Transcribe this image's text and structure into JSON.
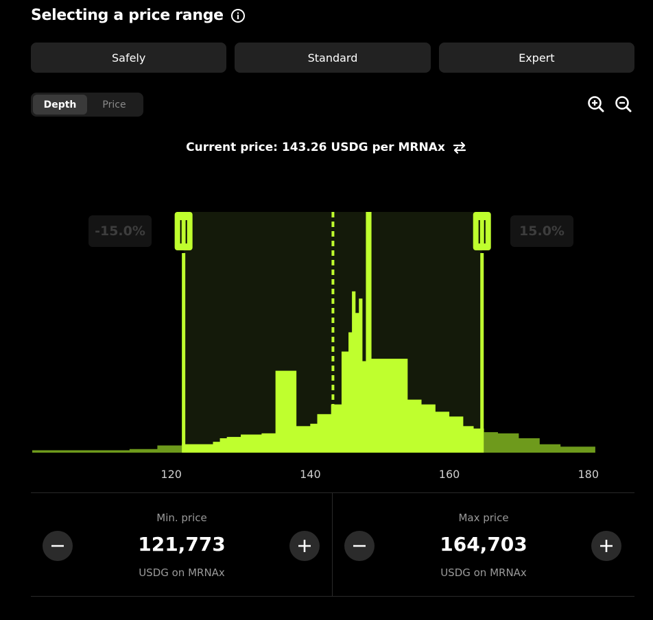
{
  "header": {
    "title": "Selecting a price range",
    "info_icon": "info-circle-icon"
  },
  "strategies": [
    {
      "label": "Safely"
    },
    {
      "label": "Standard"
    },
    {
      "label": "Expert"
    }
  ],
  "view_toggle": {
    "options": [
      "Depth",
      "Price"
    ],
    "selected": "Depth"
  },
  "zoom": {
    "in_icon": "zoom-in-icon",
    "out_icon": "zoom-out-icon"
  },
  "current_price": {
    "text": "Current price: 143.26 USDG per MRNAx",
    "value": 143.26,
    "swap_icon": "swap-arrows-icon"
  },
  "range_labels": {
    "lower_pct": "-15.0%",
    "upper_pct": "15.0%"
  },
  "colors": {
    "accent": "#BFFF2E",
    "accent_dim": "#6E9A1C",
    "range_fill": "#141A0A",
    "background": "#000000"
  },
  "chart_data": {
    "type": "area",
    "x_ticks": [
      120,
      140,
      160,
      180
    ],
    "xlim": [
      100,
      182
    ],
    "selected_range": [
      121.773,
      164.703
    ],
    "current_price": 143.26,
    "bins": [
      [
        100,
        0.01
      ],
      [
        114,
        0.015
      ],
      [
        118,
        0.03
      ],
      [
        121.5,
        0.035
      ],
      [
        124,
        0.035
      ],
      [
        126,
        0.045
      ],
      [
        127,
        0.06
      ],
      [
        128,
        0.065
      ],
      [
        130,
        0.075
      ],
      [
        133,
        0.08
      ],
      [
        135,
        0.34
      ],
      [
        138,
        0.11
      ],
      [
        140,
        0.12
      ],
      [
        141,
        0.16
      ],
      [
        143,
        0.2
      ],
      [
        144.5,
        0.42
      ],
      [
        145.5,
        0.5
      ],
      [
        146,
        0.67
      ],
      [
        146.5,
        0.58
      ],
      [
        147,
        0.64
      ],
      [
        147.5,
        0.38
      ],
      [
        148,
        1.0
      ],
      [
        148.8,
        0.39
      ],
      [
        151,
        0.39
      ],
      [
        154,
        0.22
      ],
      [
        156,
        0.2
      ],
      [
        158,
        0.17
      ],
      [
        160,
        0.15
      ],
      [
        162,
        0.11
      ],
      [
        163.5,
        0.1
      ],
      [
        165,
        0.085
      ],
      [
        167,
        0.08
      ],
      [
        170,
        0.06
      ],
      [
        173,
        0.035
      ],
      [
        176,
        0.025
      ],
      [
        181,
        0.0
      ]
    ]
  },
  "min_price": {
    "label": "Min. price",
    "value": "121,773",
    "unit": "USDG on MRNAx"
  },
  "max_price": {
    "label": "Max price",
    "value": "164,703",
    "unit": "USDG on MRNAx"
  }
}
